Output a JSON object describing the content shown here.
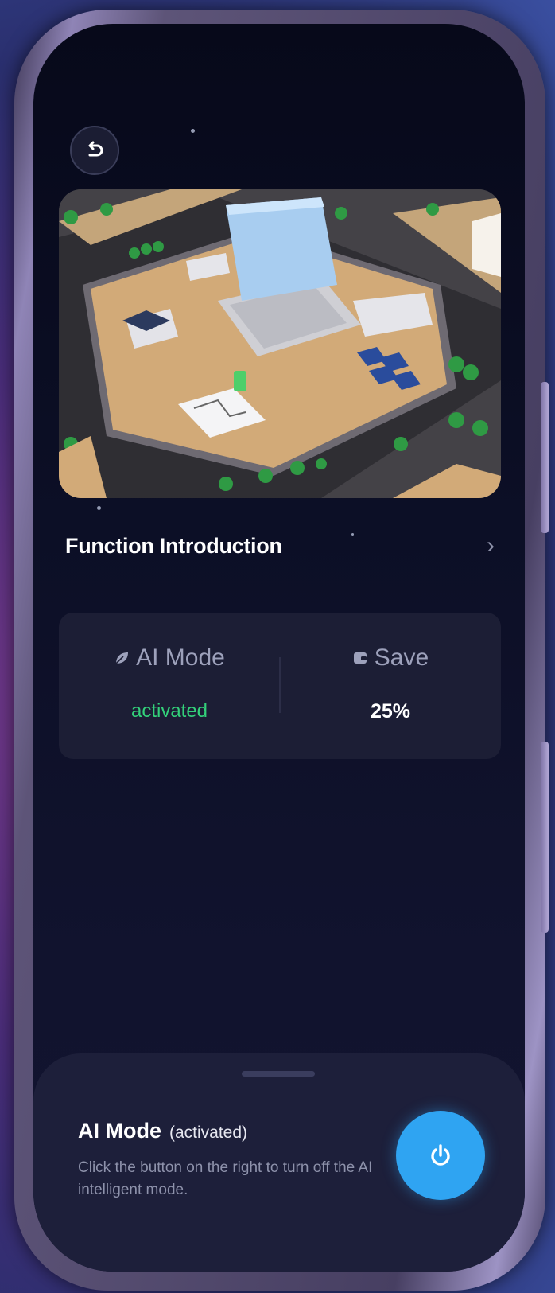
{
  "hero": {
    "image_alt": "Isometric smart energy campus illustration"
  },
  "function_intro": {
    "label": "Function Introduction",
    "chevron_icon": "chevron-right-icon"
  },
  "status": {
    "ai_mode": {
      "label": "AI Mode",
      "value": "activated",
      "icon": "leaf-icon",
      "value_color": "#33d17a"
    },
    "save": {
      "label": "Save",
      "value": "25%",
      "icon": "wallet-icon"
    }
  },
  "sheet": {
    "title": "AI Mode",
    "status": "(activated)",
    "description": "Click the button on the right to turn off the AI intelligent mode.",
    "power_icon": "power-icon",
    "accent": "#2fa4f2"
  },
  "back_icon": "undo-icon"
}
